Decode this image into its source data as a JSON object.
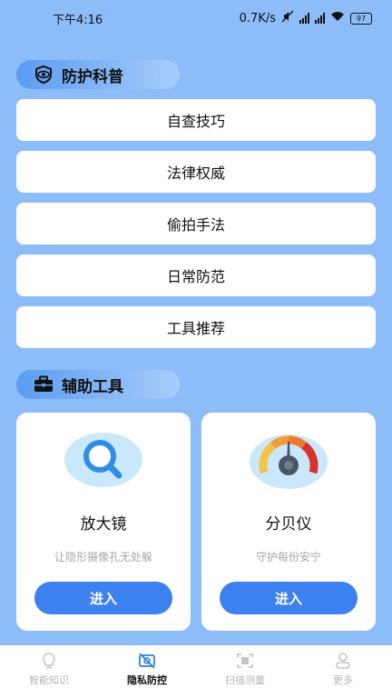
{
  "status_bar": {
    "time": "下午4:16",
    "network_speed": "0.7K/s",
    "battery": "97"
  },
  "section_popular_science": {
    "title": "防护科普",
    "icon": "eye-shield-icon"
  },
  "menu_items": [
    {
      "label": "自查技巧"
    },
    {
      "label": "法律权威"
    },
    {
      "label": "偷拍手法"
    },
    {
      "label": "日常防范"
    },
    {
      "label": "工具推荐"
    }
  ],
  "section_tools": {
    "title": "辅助工具",
    "icon": "briefcase-icon"
  },
  "tools": [
    {
      "title": "放大镜",
      "subtitle": "让隐形摄像孔无处躲",
      "button": "进入",
      "icon": "magnifier-icon"
    },
    {
      "title": "分贝仪",
      "subtitle": "守护每份安宁",
      "button": "进入",
      "icon": "decibel-gauge-icon"
    }
  ],
  "tab_bar": {
    "tabs": [
      {
        "label": "智能知识",
        "icon": "bulb-icon",
        "active": false
      },
      {
        "label": "隐私防控",
        "icon": "camera-off-icon",
        "active": true
      },
      {
        "label": "扫描测量",
        "icon": "scan-icon",
        "active": false
      },
      {
        "label": "更多",
        "icon": "user-icon",
        "active": false
      }
    ]
  },
  "colors": {
    "background": "#8cbdf8",
    "accent": "#3d80ef",
    "card": "#ffffff",
    "inactive_tab": "#b5b5b5"
  }
}
